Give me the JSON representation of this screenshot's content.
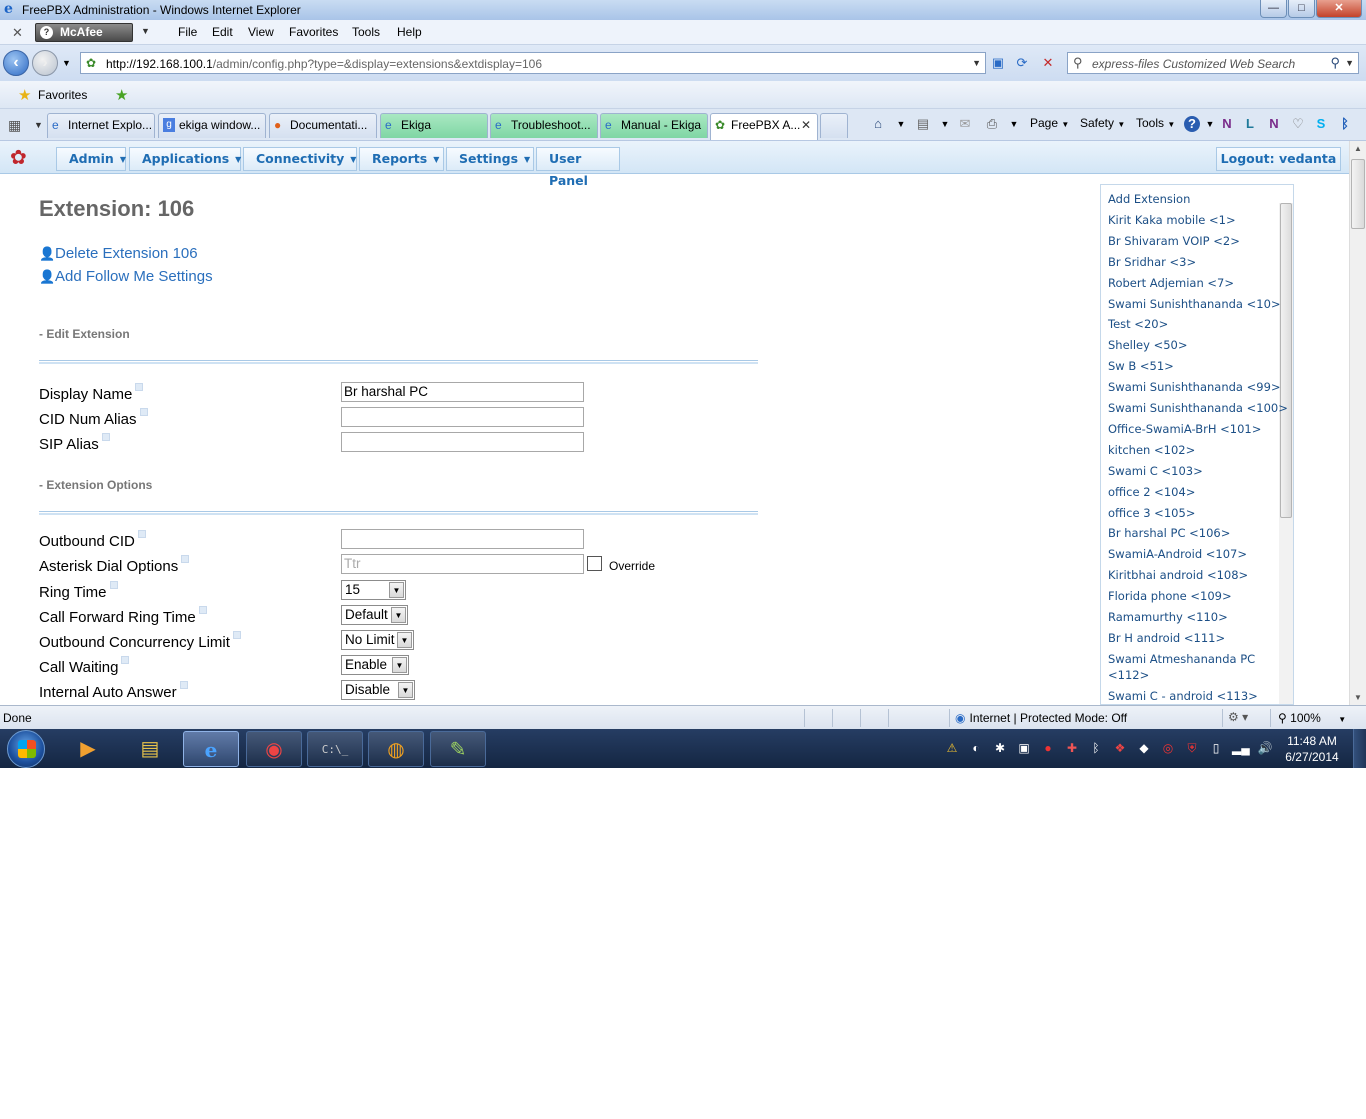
{
  "window": {
    "title": "FreePBX Administration - Windows Internet Explorer",
    "buttons": {
      "minimize": "—",
      "maximize": "□",
      "close": "✕"
    }
  },
  "menubar": {
    "mcafee": "McAfee",
    "items": [
      "File",
      "Edit",
      "View",
      "Favorites",
      "Tools",
      "Help"
    ]
  },
  "address": {
    "url_host": "http://192.168.100.1",
    "url_path": "/admin/config.php?type=&display=extensions&extdisplay=106",
    "search_placeholder": "express-files Customized Web Search"
  },
  "favorites": {
    "label": "Favorites"
  },
  "tabs": [
    {
      "label": "Internet Explo...",
      "icon": "ie-icon",
      "green": false,
      "active": false
    },
    {
      "label": "ekiga window...",
      "icon": "google-icon",
      "green": false,
      "active": false
    },
    {
      "label": "Documentati...",
      "icon": "firefox-icon",
      "green": false,
      "active": false
    },
    {
      "label": "Ekiga",
      "icon": "ie-icon",
      "green": true,
      "active": false
    },
    {
      "label": "Troubleshoot...",
      "icon": "ie-icon",
      "green": true,
      "active": false
    },
    {
      "label": "Manual - Ekiga",
      "icon": "ie-icon",
      "green": true,
      "active": false
    },
    {
      "label": "FreePBX A...",
      "icon": "freepbx-icon",
      "green": false,
      "active": true
    }
  ],
  "command_bar": {
    "page": "Page",
    "safety": "Safety",
    "tools": "Tools"
  },
  "pbx_nav": {
    "items": [
      "Admin",
      "Applications",
      "Connectivity",
      "Reports",
      "Settings",
      "User Panel"
    ],
    "logout": "Logout: vedanta"
  },
  "page": {
    "title": "Extension: 106",
    "delete_link": "Delete Extension 106",
    "followme_link": "Add Follow Me Settings",
    "section_edit": "- Edit Extension",
    "section_options": "- Extension Options"
  },
  "fields": {
    "display_name": {
      "label": "Display Name",
      "value": "Br harshal PC"
    },
    "cid_num_alias": {
      "label": "CID Num Alias",
      "value": ""
    },
    "sip_alias": {
      "label": "SIP Alias",
      "value": ""
    },
    "outbound_cid": {
      "label": "Outbound CID",
      "value": ""
    },
    "dial_options": {
      "label": "Asterisk Dial Options",
      "value": "Ttr",
      "override_label": "Override"
    },
    "ring_time": {
      "label": "Ring Time",
      "value": "15"
    },
    "cf_ring_time": {
      "label": "Call Forward Ring Time",
      "value": "Default"
    },
    "concurrency": {
      "label": "Outbound Concurrency Limit",
      "value": "No Limit"
    },
    "call_waiting": {
      "label": "Call Waiting",
      "value": "Enable"
    },
    "auto_answer": {
      "label": "Internal Auto Answer",
      "value": "Disable"
    }
  },
  "ext_list": [
    "Add Extension",
    "Kirit Kaka mobile <1>",
    "Br Shivaram VOIP <2>",
    "Br Sridhar <3>",
    "Robert Adjemian <7>",
    "Swami Sunishthananda <10>",
    "Test <20>",
    "Shelley <50>",
    "Sw B <51>",
    "Swami Sunishthananda <99>",
    "Swami Sunishthananda <100>",
    "Office-SwamiA-BrH <101>",
    "kitchen <102>",
    "Swami C <103>",
    "office 2 <104>",
    "office 3 <105>",
    "Br harshal PC <106>",
    "SwamiA-Android <107>",
    "Kiritbhai android <108>",
    "Florida phone <109>",
    "Ramamurthy <110>",
    "Br H android <111>",
    "Swami Atmeshananda PC",
    "<112>",
    "Swami C - android <113>"
  ],
  "status": {
    "left": "Done",
    "zone": "Internet | Protected Mode: Off",
    "zoom": "100%"
  },
  "clock": {
    "time": "11:48 AM",
    "date": "6/27/2014"
  }
}
